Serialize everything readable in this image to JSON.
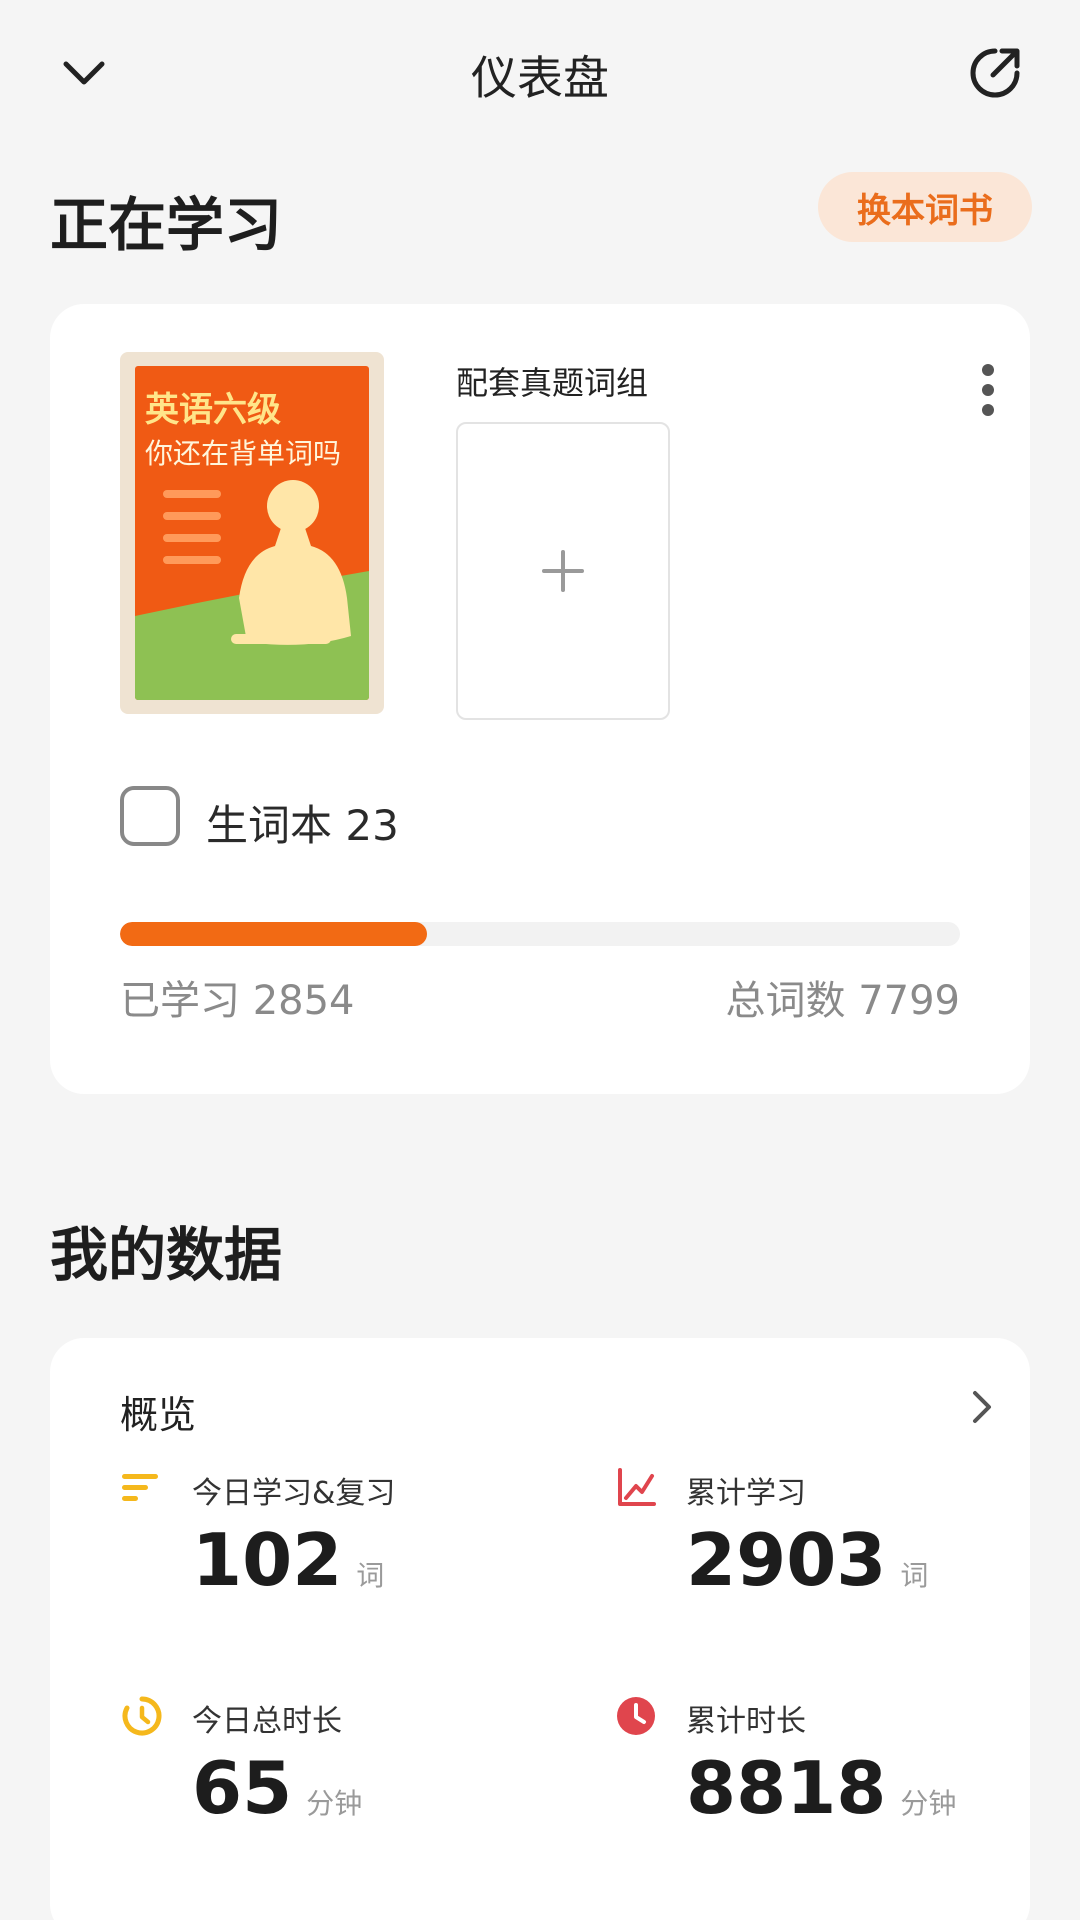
{
  "header": {
    "title": "仪表盘",
    "back_icon": "chevron-down-icon",
    "share_icon": "share-circle-icon"
  },
  "learning": {
    "section_title": "正在学习",
    "swap_button": "换本词书",
    "book": {
      "cover_title": "英语六级",
      "cover_subtitle": "你还在背单词吗"
    },
    "addon_label": "配套真题词组",
    "vocab_book_label": "生词本 23",
    "progress": {
      "learned_label": "已学习 2854",
      "total_label": "总词数 7799",
      "learned": 2854,
      "total": 7799
    }
  },
  "data": {
    "section_title": "我的数据",
    "overview_label": "概览",
    "stats": [
      {
        "label": "今日学习&复习",
        "value": "102",
        "unit": "词",
        "icon": "bars-icon",
        "color": "#f5b81c"
      },
      {
        "label": "累计学习",
        "value": "2903",
        "unit": "词",
        "icon": "line-chart-icon",
        "color": "#e0454d"
      },
      {
        "label": "今日总时长",
        "value": "65",
        "unit": "分钟",
        "icon": "timer-icon",
        "color": "#f5b81c"
      },
      {
        "label": "累计时长",
        "value": "8818",
        "unit": "分钟",
        "icon": "clock-icon",
        "color": "#e0454d"
      }
    ]
  },
  "colors": {
    "accent": "#f26a14",
    "swap_button_bg": "#fbe6d7",
    "swap_button_text": "#ea6d1c"
  }
}
